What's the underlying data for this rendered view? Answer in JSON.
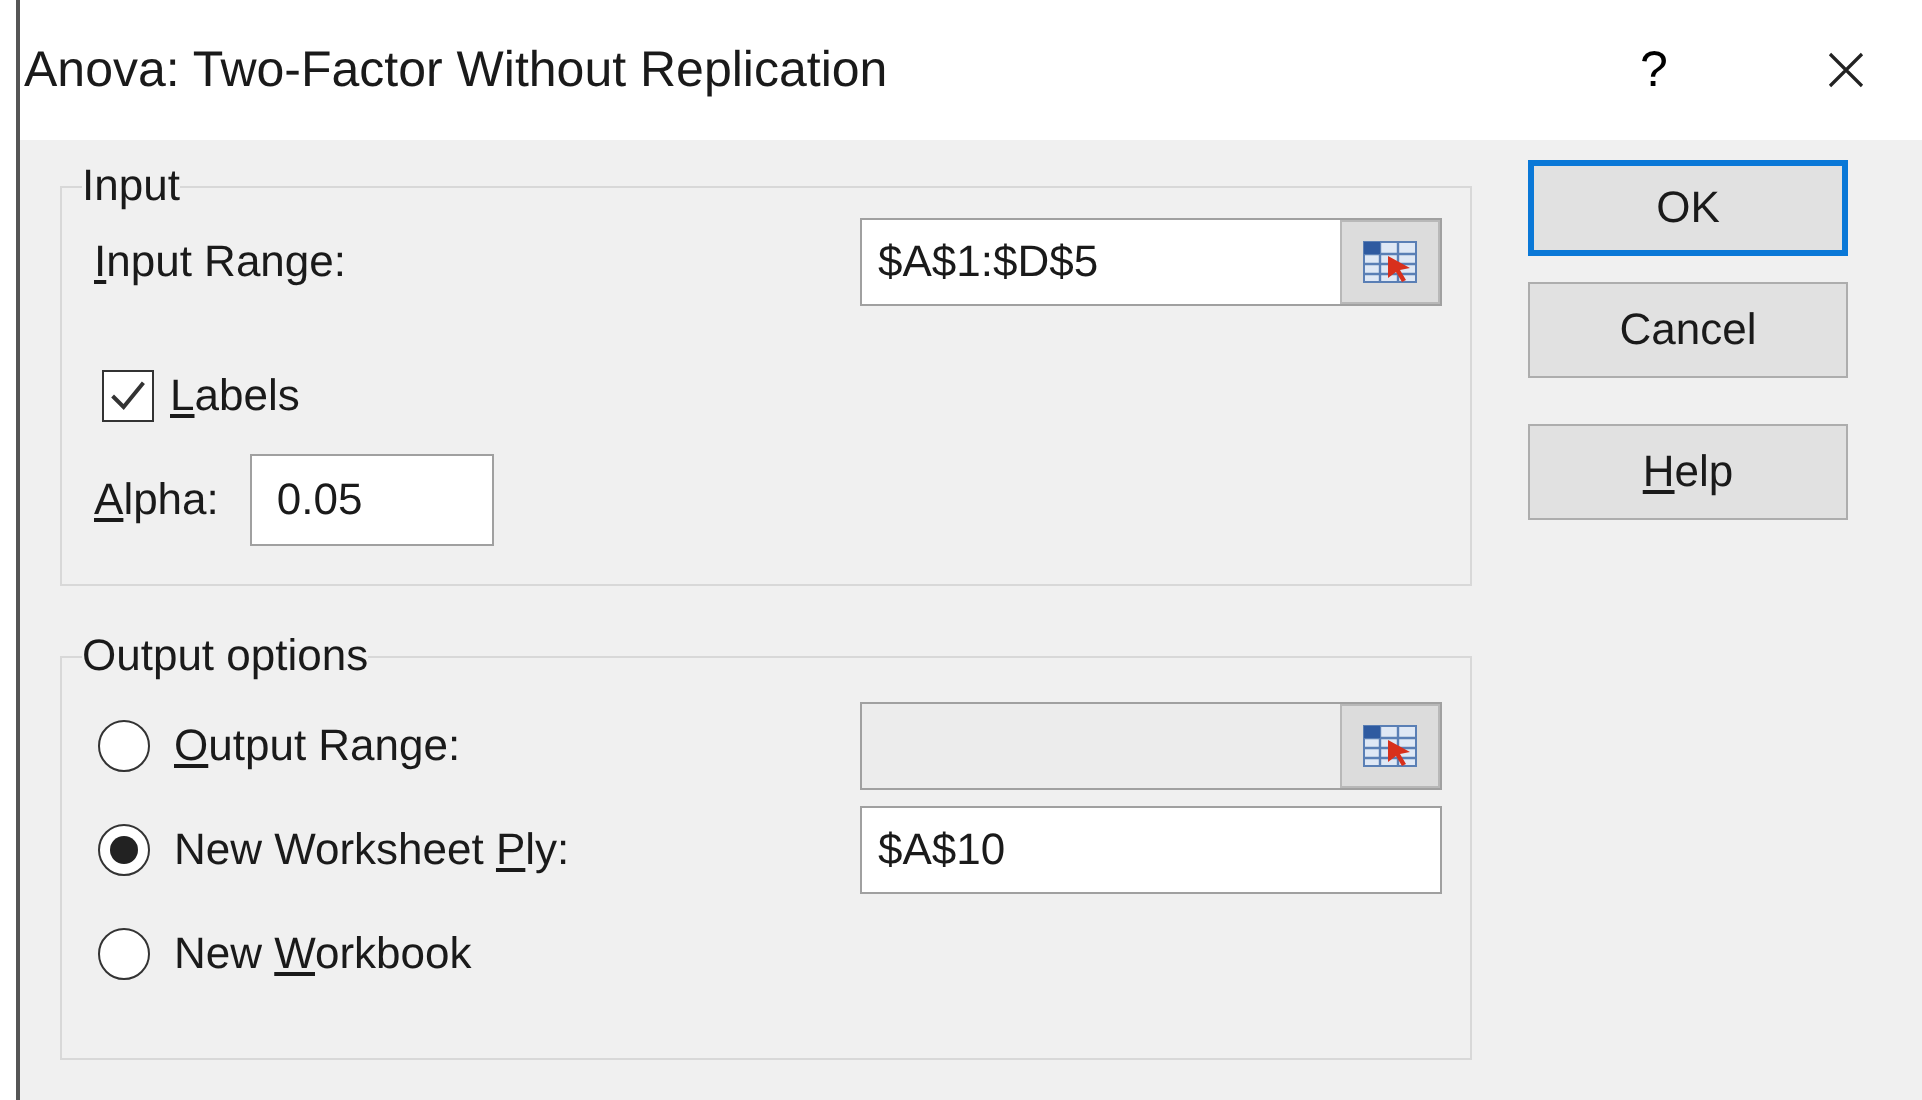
{
  "window": {
    "title": "Anova: Two-Factor Without Replication",
    "help": "?"
  },
  "input_group": {
    "title": "Input",
    "input_range": {
      "label": {
        "key": "I",
        "post": "nput Range:"
      },
      "value": "$A$1:$D$5"
    },
    "labels": {
      "label": {
        "key": "L",
        "post": "abels"
      },
      "checked": true
    },
    "alpha": {
      "label": {
        "key": "A",
        "post": "lpha:"
      },
      "value": "0.05"
    }
  },
  "output_group": {
    "title": "Output options",
    "options": [
      {
        "kind": "picker",
        "label": {
          "key": "O",
          "post": "utput Range:"
        },
        "selected": false,
        "field": {
          "disabled": true
        }
      },
      {
        "kind": "field",
        "label": {
          "pre": "New Worksheet ",
          "key": "P",
          "post": "ly:"
        },
        "selected": true,
        "field": {
          "value": "$A$10",
          "disabled": false
        }
      },
      {
        "kind": "plain",
        "label": {
          "pre": "New ",
          "key": "W",
          "post": "orkbook"
        },
        "selected": false
      }
    ]
  },
  "buttons": [
    {
      "label": {
        "pre": "OK"
      },
      "default": true
    },
    {
      "label": {
        "pre": "Cancel"
      },
      "default": false
    },
    {
      "label": {
        "key": "H",
        "post": "elp"
      },
      "default": false
    }
  ]
}
